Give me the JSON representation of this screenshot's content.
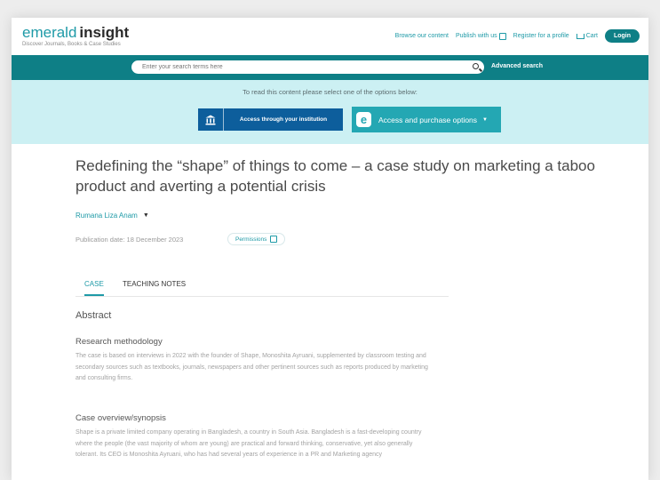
{
  "header": {
    "logo_word1": "emerald",
    "logo_word2": "insight",
    "logo_tagline": "Discover Journals, Books & Case Studies",
    "nav": {
      "browse": "Browse our content",
      "publish": "Publish with us",
      "register": "Register for a profile",
      "cart": "Cart",
      "login": "Login"
    }
  },
  "search": {
    "placeholder": "Enter your search terms here",
    "advanced": "Advanced search"
  },
  "access": {
    "message": "To read this content please select one of the options below:",
    "institution_label": "Access through your institution",
    "purchase_label": "Access and purchase options"
  },
  "article": {
    "title": "Redefining the “shape” of things to come – a case study on marketing a taboo product and averting a potential crisis",
    "author": "Rumana Liza Anam",
    "publication_date": "Publication date: 18 December 2023",
    "permissions": "Permissions"
  },
  "tabs": {
    "case": "CASE",
    "teaching_notes": "TEACHING NOTES"
  },
  "abstract": {
    "heading": "Abstract",
    "sections": [
      {
        "heading": "Research methodology",
        "text": "The case is based on interviews in 2022 with the founder of Shape, Monoshita Ayruani, supplemented by classroom testing and secondary sources such as textbooks, journals, newspapers and other pertinent sources such as reports produced by marketing and consulting firms."
      },
      {
        "heading": "Case overview/synopsis",
        "text": "Shape is a private limited company operating in Bangladesh, a country in South Asia. Bangladesh is a fast-developing country where the people (the vast majority of whom are young) are practical and forward thinking, conservative, yet also generally tolerant. Its CEO is Monoshita Ayruani, who has had several years of experience in a PR and Marketing agency"
      }
    ]
  },
  "colors": {
    "brand_teal": "#0e7f86",
    "link_teal": "#1e9aa7",
    "access_bg": "#ccf0f3",
    "institution_blue": "#0d5e9c"
  }
}
